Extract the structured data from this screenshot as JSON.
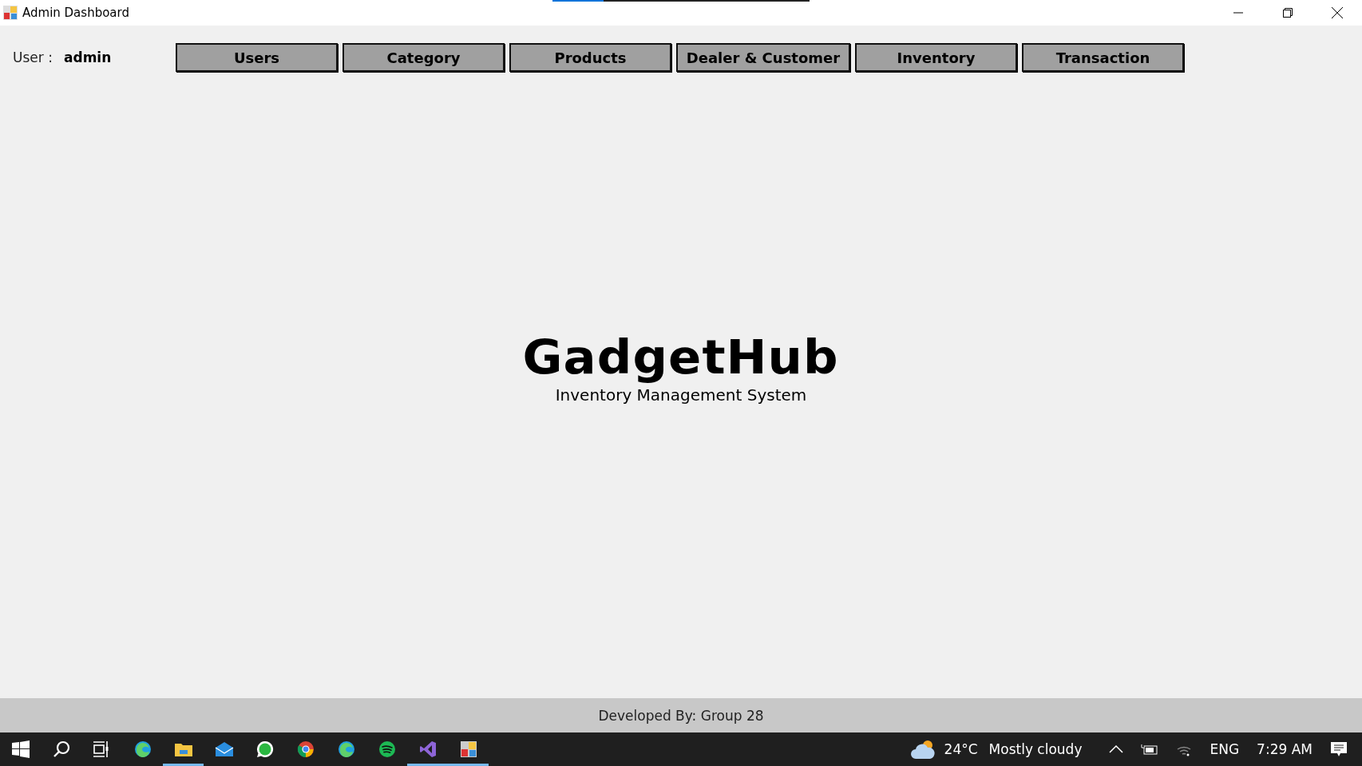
{
  "window": {
    "title": "Admin Dashboard",
    "loading": {
      "level": 0.2
    }
  },
  "user": {
    "label": "User :",
    "name": "admin"
  },
  "nav": [
    "Users",
    "Category",
    "Products",
    "Dealer & Customer",
    "Inventory",
    "Transaction"
  ],
  "brand": {
    "name": "GadgetHub",
    "tagline": "Inventory Management System"
  },
  "footer": "Developed By: Group 28",
  "taskbar": {
    "apps": [
      {
        "kind": "start",
        "running": false
      },
      {
        "kind": "search",
        "running": false
      },
      {
        "kind": "taskview",
        "running": false
      },
      {
        "kind": "edge",
        "running": false
      },
      {
        "kind": "folder",
        "running": true
      },
      {
        "kind": "mail",
        "running": false
      },
      {
        "kind": "whatsapp",
        "running": false
      },
      {
        "kind": "chrome",
        "running": false
      },
      {
        "kind": "edge",
        "running": false
      },
      {
        "kind": "spotify",
        "running": false
      },
      {
        "kind": "vs",
        "running": true
      },
      {
        "kind": "app",
        "running": true
      }
    ],
    "weather": {
      "temp": "24°C",
      "text": "Mostly cloudy"
    },
    "language": "ENG",
    "time": "7:29 AM"
  }
}
